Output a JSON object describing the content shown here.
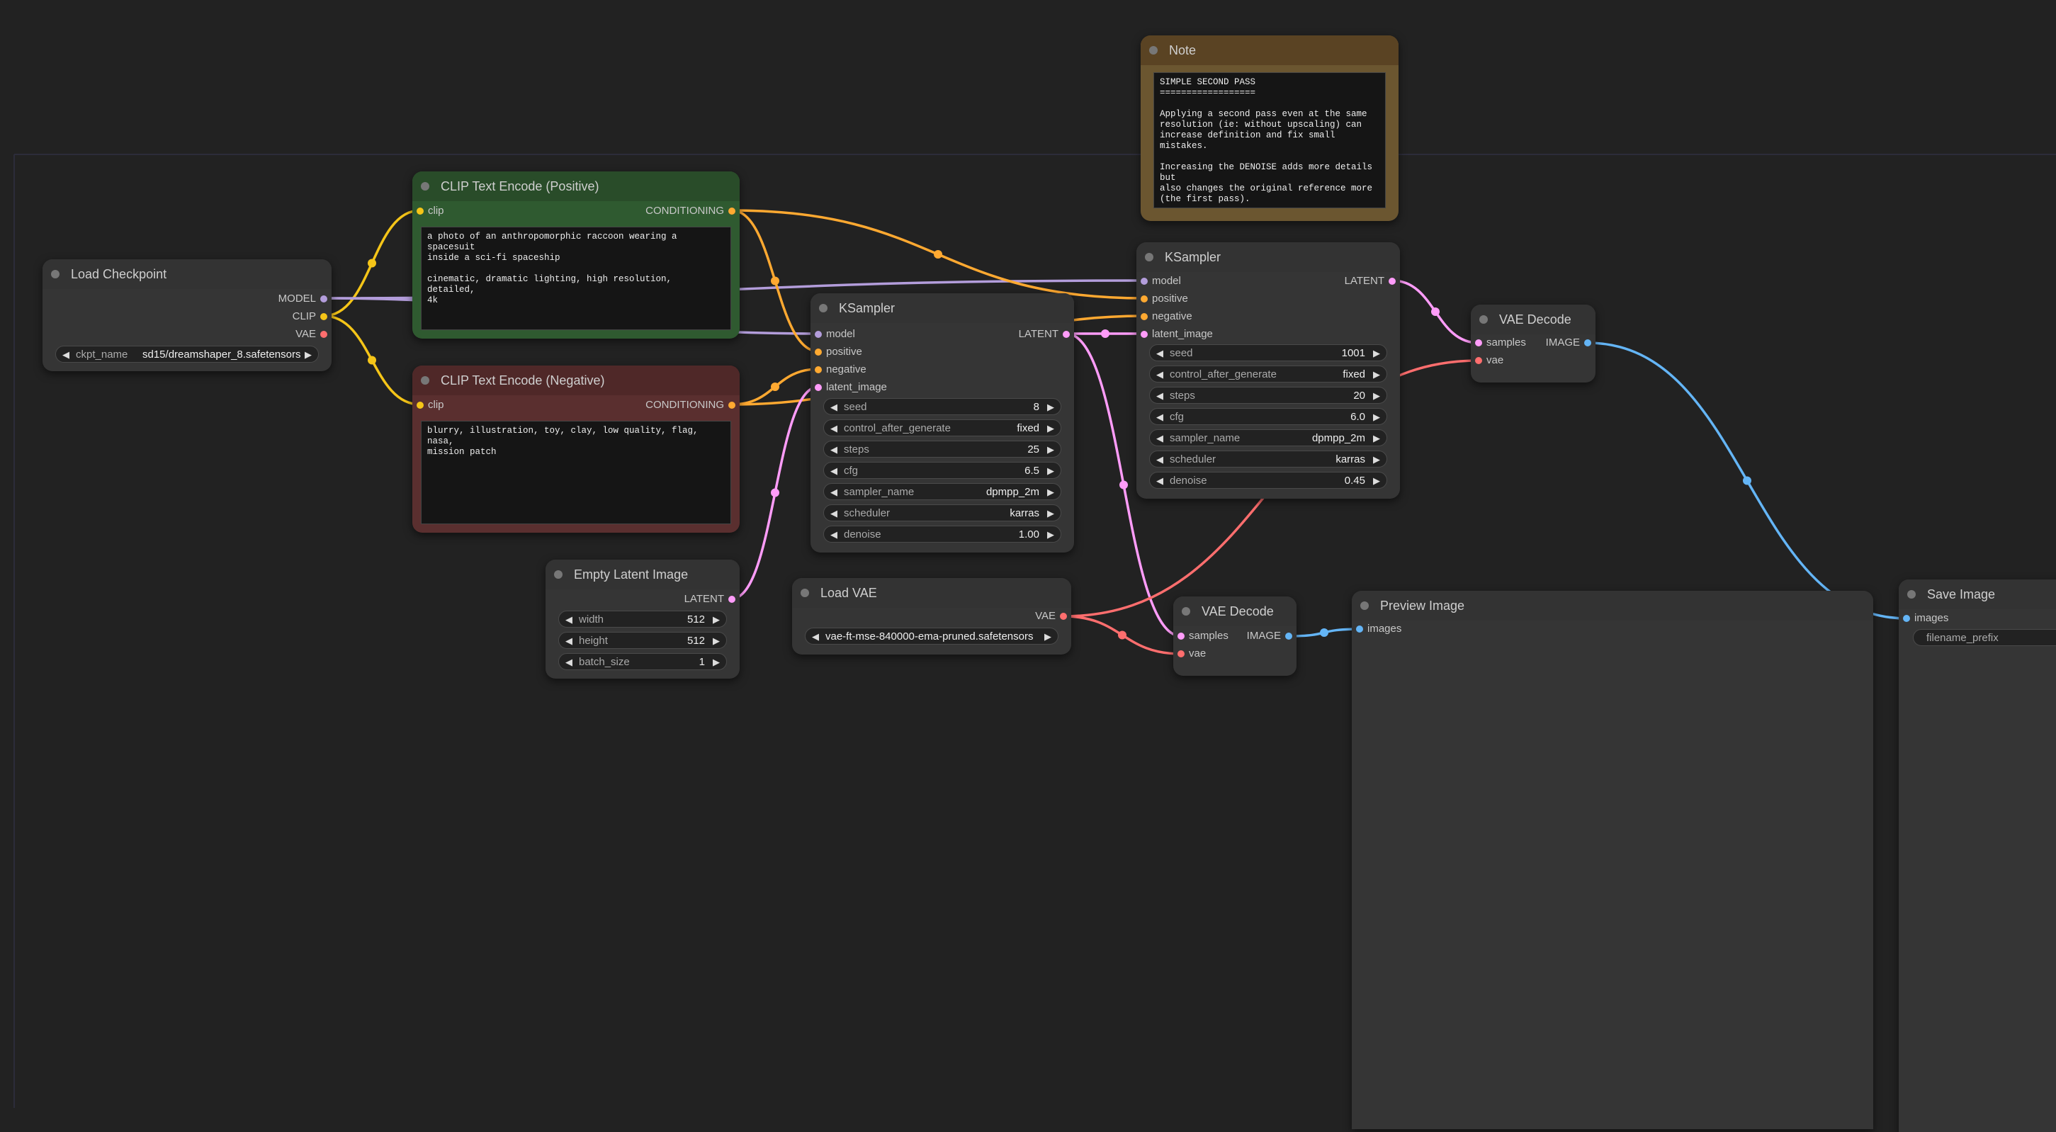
{
  "colors": {
    "background": "#222222",
    "node_body": "#353535",
    "model": "#b39ddb",
    "clip": "#f5c518",
    "vae": "#ff6e6e",
    "conditioning": "#ffa931",
    "latent": "#ff9cf9",
    "image": "#64b5f6",
    "positive_body": "#2f5a30",
    "positive_header": "#294c29",
    "negative_body": "#5a2f2f",
    "negative_header": "#4f2828",
    "note_body": "#6b5630",
    "note_header": "#5a4323"
  },
  "note": {
    "title": "Note",
    "text": "SIMPLE SECOND PASS\n==================\n\nApplying a second pass even at the same\nresolution (ie: without upscaling) can\nincrease definition and fix small mistakes.\n\nIncreasing the DENOISE adds more details but\nalso changes the original reference more\n(the first pass)."
  },
  "load_checkpoint": {
    "title": "Load Checkpoint",
    "outputs": [
      "MODEL",
      "CLIP",
      "VAE"
    ],
    "ckpt_label": "ckpt_name",
    "ckpt_value": "sd15/dreamshaper_8.safetensors"
  },
  "clip_positive": {
    "title": "CLIP Text Encode (Positive)",
    "input": "clip",
    "output": "CONDITIONING",
    "text": "a photo of an anthropomorphic raccoon wearing a spacesuit\ninside a sci-fi spaceship\n\ncinematic, dramatic lighting, high resolution, detailed,\n4k"
  },
  "clip_negative": {
    "title": "CLIP Text Encode (Negative)",
    "input": "clip",
    "output": "CONDITIONING",
    "text": "blurry, illustration, toy, clay, low quality, flag, nasa,\nmission patch"
  },
  "ksampler1": {
    "title": "KSampler",
    "inputs": [
      "model",
      "positive",
      "negative",
      "latent_image"
    ],
    "output": "LATENT",
    "widgets": [
      {
        "label": "seed",
        "value": "8"
      },
      {
        "label": "control_after_generate",
        "value": "fixed"
      },
      {
        "label": "steps",
        "value": "25"
      },
      {
        "label": "cfg",
        "value": "6.5"
      },
      {
        "label": "sampler_name",
        "value": "dpmpp_2m"
      },
      {
        "label": "scheduler",
        "value": "karras"
      },
      {
        "label": "denoise",
        "value": "1.00"
      }
    ]
  },
  "ksampler2": {
    "title": "KSampler",
    "inputs": [
      "model",
      "positive",
      "negative",
      "latent_image"
    ],
    "output": "LATENT",
    "widgets": [
      {
        "label": "seed",
        "value": "1001"
      },
      {
        "label": "control_after_generate",
        "value": "fixed"
      },
      {
        "label": "steps",
        "value": "20"
      },
      {
        "label": "cfg",
        "value": "6.0"
      },
      {
        "label": "sampler_name",
        "value": "dpmpp_2m"
      },
      {
        "label": "scheduler",
        "value": "karras"
      },
      {
        "label": "denoise",
        "value": "0.45"
      }
    ]
  },
  "empty_latent": {
    "title": "Empty Latent Image",
    "output": "LATENT",
    "widgets": [
      {
        "label": "width",
        "value": "512"
      },
      {
        "label": "height",
        "value": "512"
      },
      {
        "label": "batch_size",
        "value": "1"
      }
    ]
  },
  "load_vae": {
    "title": "Load VAE",
    "output": "VAE",
    "vae_value": "vae-ft-mse-840000-ema-pruned.safetensors"
  },
  "vae_decode1": {
    "title": "VAE Decode",
    "inputs": [
      "samples",
      "vae"
    ],
    "output": "IMAGE"
  },
  "vae_decode2": {
    "title": "VAE Decode",
    "inputs": [
      "samples",
      "vae"
    ],
    "output": "IMAGE"
  },
  "preview_image": {
    "title": "Preview Image",
    "input": "images"
  },
  "save_image": {
    "title": "Save Image",
    "input": "images",
    "widget_label": "filename_prefix"
  }
}
